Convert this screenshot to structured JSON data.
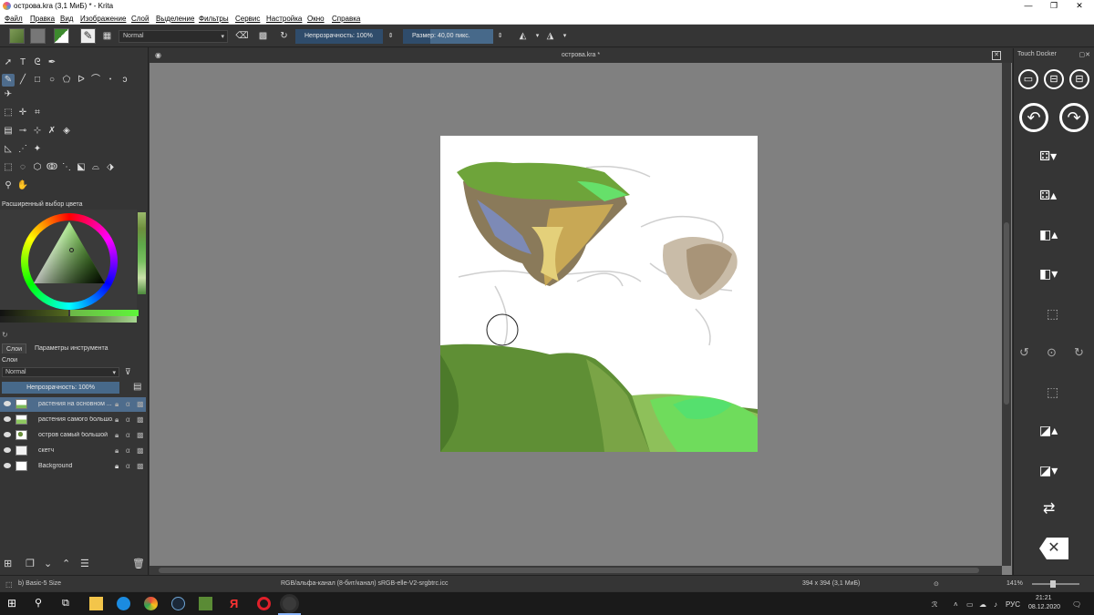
{
  "window": {
    "title": "острова.kra (3,1 МиБ)  * - Krita",
    "min": "—",
    "max": "❐",
    "close": "✕"
  },
  "menu": [
    "Файл",
    "Правка",
    "Вид",
    "Изображение",
    "Слой",
    "Выделение",
    "Фильтры",
    "Сервис",
    "Настройка",
    "Окно",
    "Справка"
  ],
  "toolbar": {
    "blend_mode": "Normal",
    "opacity_label": "Непрозрачность: 100%",
    "opacity_value": 1.0,
    "size_label": "Размер: 40,00 пикс.",
    "size_value": 0.3
  },
  "document": {
    "tab_title": "острова.kra *"
  },
  "color_selector": {
    "title": "Расширенный выбор цвета"
  },
  "layers_panel": {
    "tabs": [
      "Слои",
      "Параметры инструмента"
    ],
    "title": "Слои",
    "blend_mode": "Normal",
    "opacity_label": "Непрозрачность:  100%",
    "layers": [
      {
        "name": "растения на основном ..."
      },
      {
        "name": "растения самого большо..."
      },
      {
        "name": "остров самый большой"
      },
      {
        "name": "скетч"
      },
      {
        "name": "Background"
      }
    ]
  },
  "touch_docker": {
    "title": "Touch Docker"
  },
  "status": {
    "brush": "b) Basic-5 Size",
    "color_space": "RGB/альфа-канал (8-бит/канал)  sRGB-elle-V2-srgbtrc.icc",
    "dimensions": "394 x 394 (3,1 МиБ)",
    "zoom": "141%"
  },
  "taskbar": {
    "lang": "РУС",
    "time": "21:21",
    "date": "08.12.2020"
  },
  "colors": {
    "accent": "#4e6c8c",
    "panel": "#353535",
    "canvas_bg": "#808080"
  }
}
